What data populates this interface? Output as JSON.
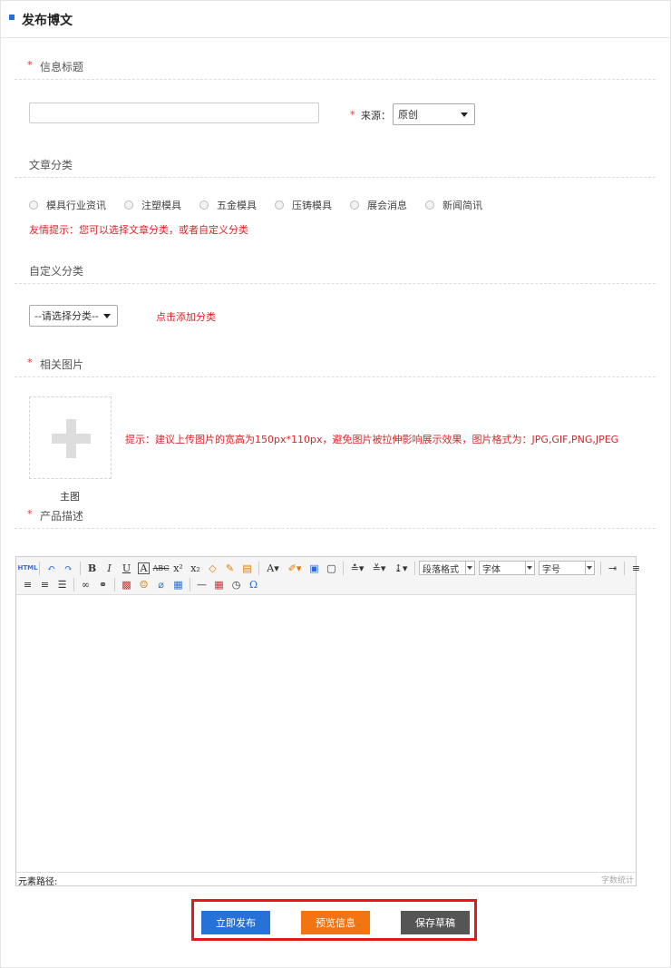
{
  "header": {
    "title": "发布博文"
  },
  "sections": {
    "info_title": {
      "star": "*",
      "label": "信息标题"
    },
    "category": {
      "label": "文章分类"
    },
    "custom_category": {
      "label": "自定义分类"
    },
    "images": {
      "star": "*",
      "label": "相关图片"
    },
    "description": {
      "star": "*",
      "label": "产品描述"
    }
  },
  "title_input": {
    "value": "",
    "placeholder": ""
  },
  "source": {
    "star": "*",
    "label": "来源：",
    "selected": "原创"
  },
  "categories": [
    "模具行业资讯",
    "注塑模具",
    "五金模具",
    "压铸模具",
    "展会消息",
    "新闻简讯"
  ],
  "category_hint": "友情提示：您可以选择文章分类，或者自定义分类",
  "custom_select": {
    "selected": "--请选择分类--"
  },
  "add_category_link": "点击添加分类",
  "upload": {
    "hint": "提示：建议上传图片的宽高为150px*110px，避免图片被拉伸影响展示效果，图片格式为：JPG,GIF,PNG,JPEG",
    "main_label": "主图"
  },
  "editor": {
    "combos": [
      "段落格式",
      "字体",
      "字号"
    ],
    "status_left": "元素路径:",
    "status_right": "字数统计",
    "icons": [
      "html-icon",
      "undo-icon",
      "redo-icon",
      "bold-icon",
      "italic-icon",
      "underline-icon",
      "font-border-icon",
      "strikethrough-icon",
      "superscript-icon",
      "subscript-icon",
      "eraser-icon",
      "format-brush-icon",
      "paste-text-icon",
      "font-color-icon",
      "highlight-icon",
      "select-all-icon",
      "clear-doc-icon",
      "row-spacing-top-icon",
      "row-spacing-bottom-icon",
      "line-height-icon",
      "indent-icon",
      "align-left-icon",
      "align-center-icon",
      "align-right-icon",
      "justify-icon",
      "link-icon",
      "unlink-icon",
      "image-icon",
      "emotion-icon",
      "attachment-icon",
      "gallery-icon",
      "horizontal-rule-icon",
      "date-icon",
      "time-icon",
      "special-char-icon"
    ]
  },
  "buttons": {
    "publish": "立即发布",
    "preview": "预览信息",
    "draft": "保存草稿"
  },
  "colors": {
    "accent": "#2772d8",
    "preview": "#f57412",
    "draft": "#555555",
    "required": "#e33333",
    "highlight_frame": "#e6161c"
  }
}
